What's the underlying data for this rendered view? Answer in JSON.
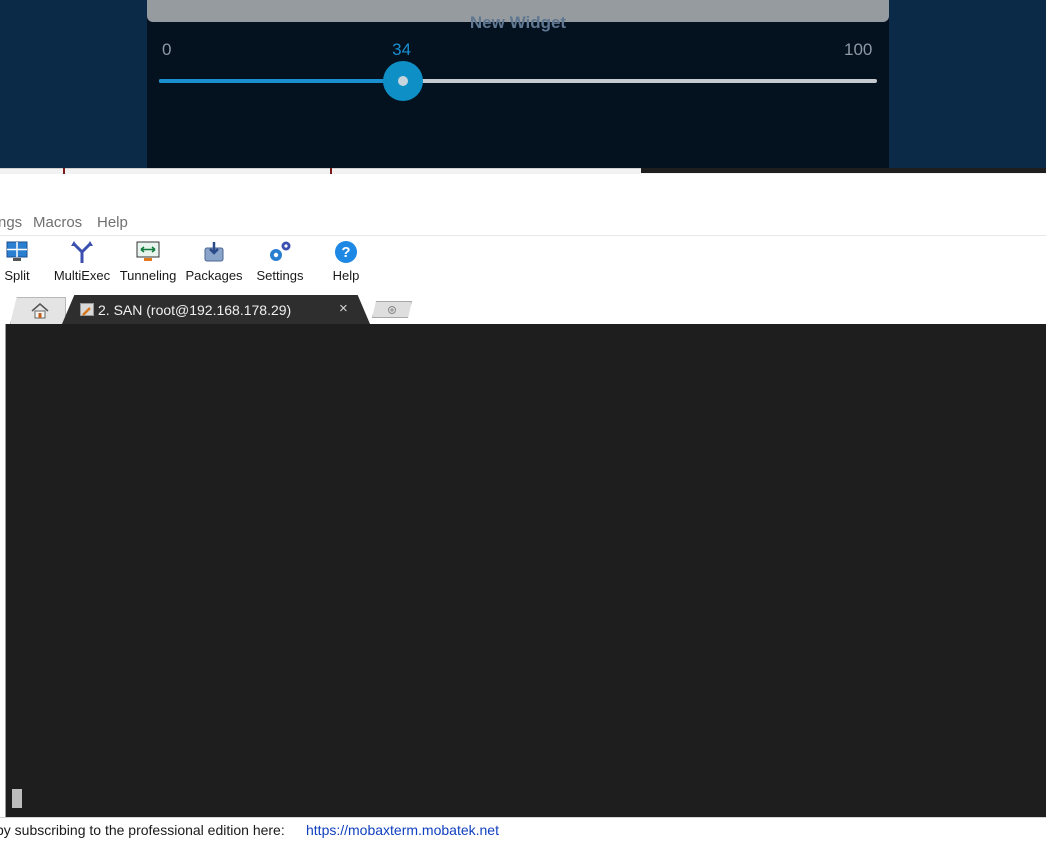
{
  "widget": {
    "title": "New Widget",
    "slider": {
      "min": "0",
      "max": "100",
      "value": "34",
      "fraction": 0.34
    },
    "colors": {
      "accent": "#1a8fcf",
      "background": "#0a2a47",
      "panel": "#04111f"
    }
  },
  "menubar": {
    "items": [
      "ngs",
      "Macros",
      "Help"
    ]
  },
  "toolbar": {
    "buttons": [
      {
        "label": "Split",
        "icon": "split-icon"
      },
      {
        "label": "MultiExec",
        "icon": "multiexec-icon"
      },
      {
        "label": "Tunneling",
        "icon": "tunneling-icon"
      },
      {
        "label": "Packages",
        "icon": "packages-icon"
      },
      {
        "label": "Settings",
        "icon": "settings-icon"
      },
      {
        "label": "Help",
        "icon": "help-icon"
      }
    ]
  },
  "tabs": {
    "home_icon": "home-icon",
    "session": {
      "label": "2. SAN (root@192.168.178.29)",
      "close": "×"
    },
    "new_tab_icon": "new-tab-icon"
  },
  "terminal": {
    "background": "#1e1e1e"
  },
  "statusbar": {
    "text": "by subscribing to the professional edition here:",
    "link": "https://mobaxterm.mobatek.net"
  }
}
